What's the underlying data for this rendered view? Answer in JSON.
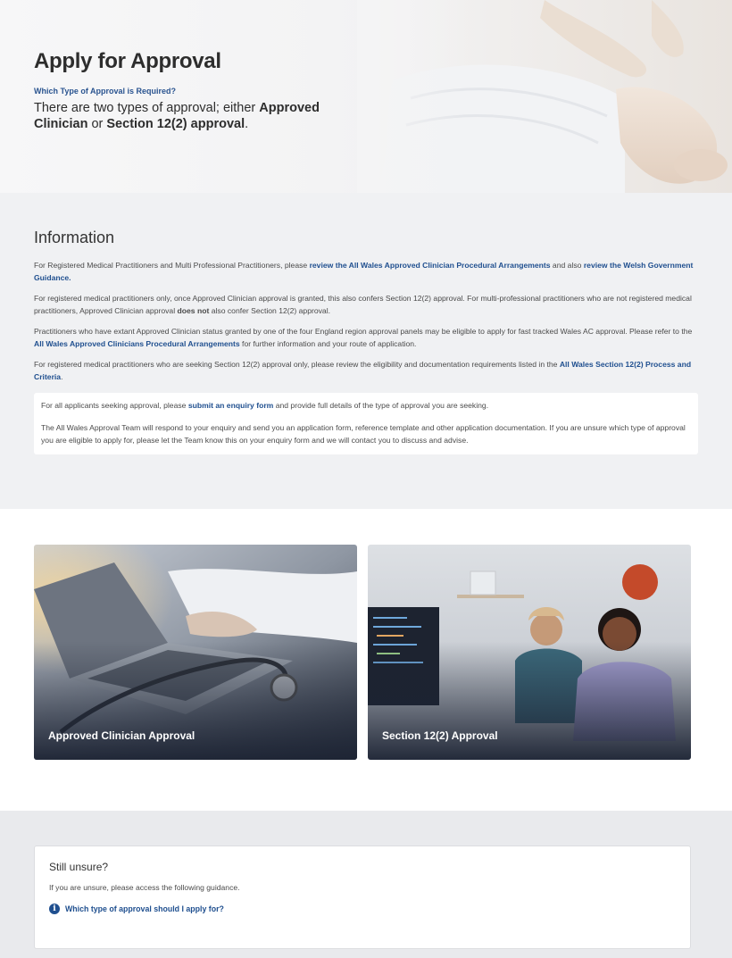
{
  "hero": {
    "title": "Apply for Approval",
    "subtitle": "Which Type of Approval is Required?",
    "lead_1": "There are two types of approval; either ",
    "lead_b1": "Approved Clinician",
    "lead_2": " or ",
    "lead_b2": "Section 12(2) approval",
    "lead_3": ".",
    "image_icon": "handshake-image"
  },
  "info": {
    "title": "Information",
    "p1_a": "For Registered Medical Practitioners and Multi Professional Practitioners, please ",
    "p1_link1": "review the All Wales Approved Clinician Procedural Arrangements",
    "p1_b": " and also ",
    "p1_link2": "review the Welsh Government Guidance.",
    "p2_a": "For registered medical practitioners only, once Approved Clinician approval is granted, this also confers Section 12(2) approval.  For multi-professional practitioners who are not registered medical practitioners, Approved Clinician approval ",
    "p2_bold": "does not",
    "p2_b": " also confer Section 12(2) approval.",
    "p3_a": "Practitioners who have extant Approved Clinician status granted by one of the four England region approval panels may be eligible to apply for fast tracked Wales AC approval. Please refer to the ",
    "p3_link": "All Wales Approved Clinicians Procedural Arrangements",
    "p3_b": " for further information and your route of application.",
    "p4_a": "For registered medical practitioners who are seeking Section 12(2) approval only, please review the eligibility and documentation requirements listed in the ",
    "p4_link": "All Wales Section 12(2) Process and Criteria",
    "p4_b": ".",
    "box_p1_a": "For all applicants seeking approval, please ",
    "box_p1_link": "submit an enquiry form",
    "box_p1_b": " and provide full details of the type of approval you are seeking.",
    "box_p2": "The All Wales Approval Team will respond to your enquiry and send you an application form, reference template and other application documentation. If you are unsure which type of approval you are eligible to apply for, please let the Team know this on your enquiry form and we will contact you to discuss and advise."
  },
  "cards": [
    {
      "label": "Approved Clinician Approval",
      "image": "laptop-stethoscope-image"
    },
    {
      "label": "Section 12(2) Approval",
      "image": "two-women-computer-image"
    }
  ],
  "unsure": {
    "title": "Still unsure?",
    "text": "If you are unsure, please access the following guidance.",
    "link": "Which type of approval should I apply for?",
    "icon": "info-icon",
    "icon_glyph": "i"
  },
  "colors": {
    "link": "#1f4f8f",
    "info_bg": "#f0f1f3",
    "unsure_bg": "#e9eaed",
    "card_overlay": "#1c2333"
  }
}
